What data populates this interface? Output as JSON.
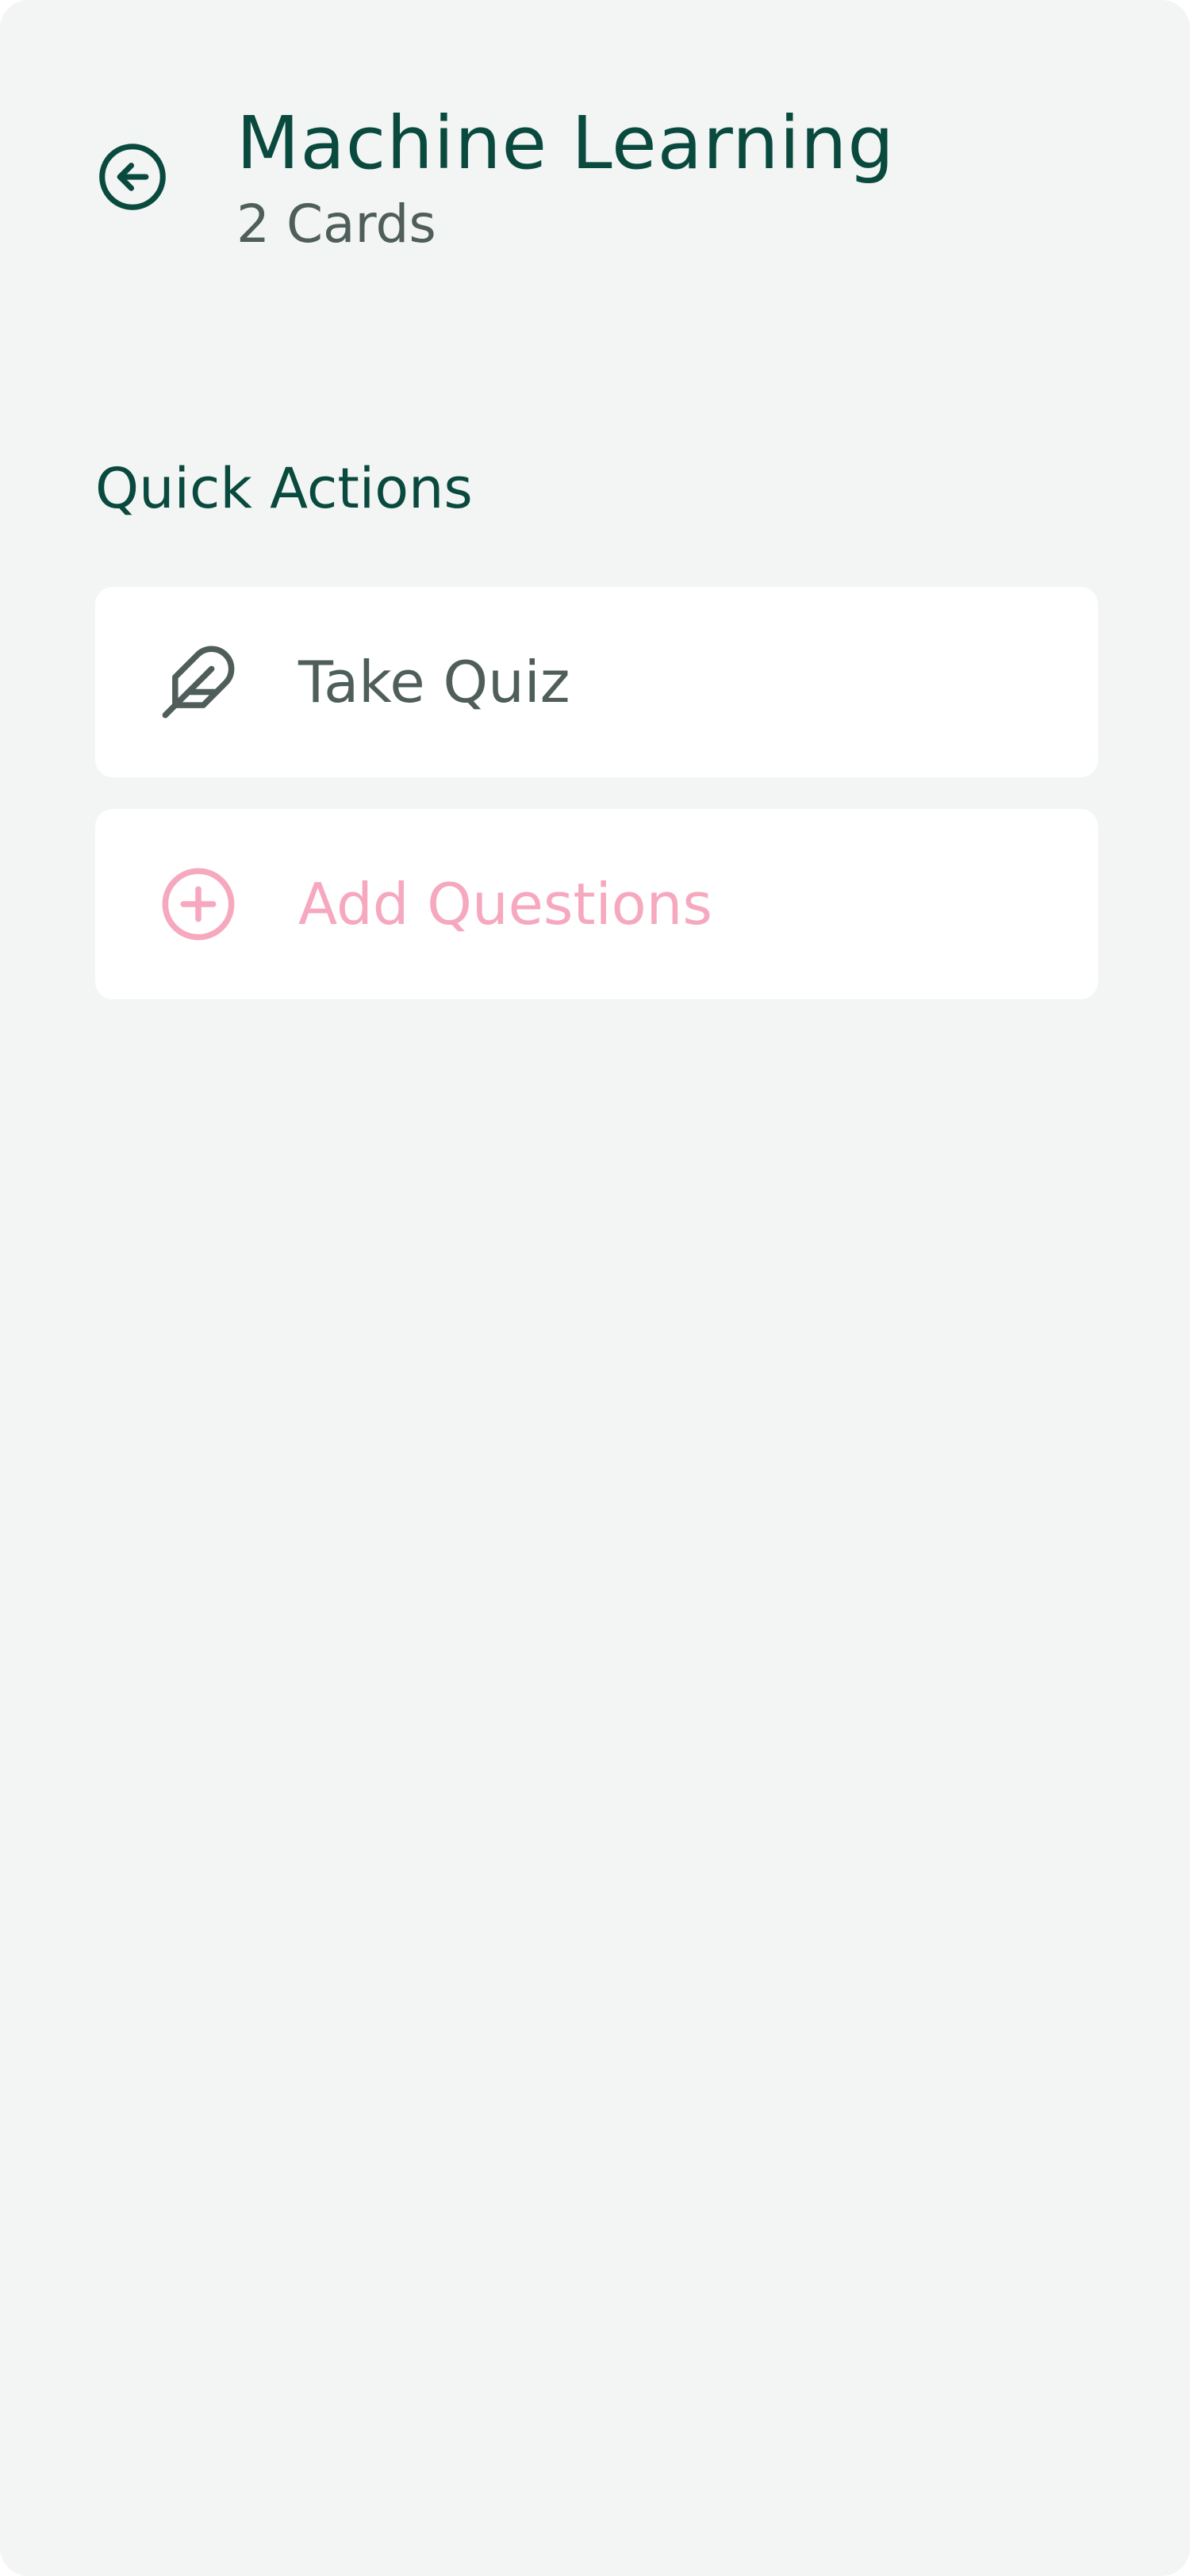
{
  "header": {
    "back_icon": "arrow-left-circle-icon",
    "title": "Machine Learning",
    "subtitle": "2 Cards"
  },
  "quick_actions": {
    "heading": "Quick Actions",
    "items": [
      {
        "label": "Take Quiz",
        "icon": "feather-icon",
        "color": "#4f5e5a"
      },
      {
        "label": "Add Questions",
        "icon": "plus-circle-icon",
        "color": "#f6a8bf"
      }
    ]
  },
  "colors": {
    "background": "#f2f5f4",
    "card": "#ffffff",
    "primary": "#0a4a3e",
    "secondary_text": "#4f5e5a",
    "accent_pink": "#f6a8bf"
  }
}
